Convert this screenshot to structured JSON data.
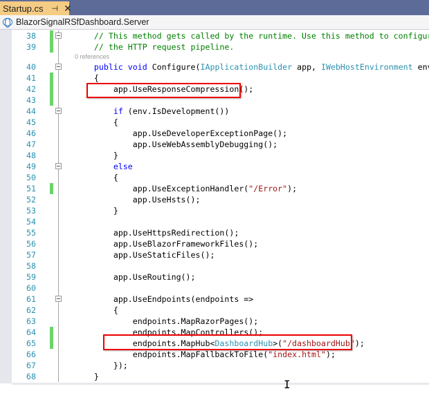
{
  "tab": {
    "label": "Startup.cs",
    "pin_icon": "pin-icon",
    "close_icon": "close-icon"
  },
  "navbar": {
    "project": "BlazorSignalRSfDashboard.Server"
  },
  "codelens": "0 references",
  "lines": [
    {
      "n": "38",
      "chg": true,
      "fold": true,
      "t": [
        [
          "    // This method gets called by the runtime. Use this method to configure",
          "c"
        ]
      ]
    },
    {
      "n": "39",
      "chg": true,
      "t": [
        [
          "    // the HTTP request pipeline.",
          "c"
        ]
      ],
      "lens_after": true
    },
    {
      "n": "40",
      "fold": true,
      "t": [
        [
          "    "
        ],
        [
          "public",
          "k"
        ],
        [
          " "
        ],
        [
          "void",
          "k"
        ],
        [
          " Configure("
        ],
        [
          "IApplicationBuilder",
          "t"
        ],
        [
          " app, "
        ],
        [
          "IWebHostEnvironment",
          "t"
        ],
        [
          " env)"
        ]
      ]
    },
    {
      "n": "41",
      "chg": true,
      "t": [
        [
          "    {"
        ]
      ]
    },
    {
      "n": "42",
      "chg": true,
      "t": [
        [
          "        app.UseResponseCompression();"
        ]
      ]
    },
    {
      "n": "43",
      "chg": true,
      "t": [
        [
          ""
        ]
      ]
    },
    {
      "n": "44",
      "fold": true,
      "t": [
        [
          "        "
        ],
        [
          "if",
          "k"
        ],
        [
          " (env.IsDevelopment())"
        ]
      ]
    },
    {
      "n": "45",
      "t": [
        [
          "        {"
        ]
      ]
    },
    {
      "n": "46",
      "t": [
        [
          "            app.UseDeveloperExceptionPage();"
        ]
      ]
    },
    {
      "n": "47",
      "t": [
        [
          "            app.UseWebAssemblyDebugging();"
        ]
      ]
    },
    {
      "n": "48",
      "t": [
        [
          "        }"
        ]
      ]
    },
    {
      "n": "49",
      "fold": true,
      "t": [
        [
          "        "
        ],
        [
          "else",
          "k"
        ]
      ]
    },
    {
      "n": "50",
      "t": [
        [
          "        {"
        ]
      ]
    },
    {
      "n": "51",
      "chg": true,
      "t": [
        [
          "            app.UseExceptionHandler("
        ],
        [
          "\"/Error\"",
          "s"
        ],
        [
          ");"
        ]
      ]
    },
    {
      "n": "52",
      "t": [
        [
          "            app.UseHsts();"
        ]
      ]
    },
    {
      "n": "53",
      "t": [
        [
          "        }"
        ]
      ]
    },
    {
      "n": "54",
      "t": [
        [
          ""
        ]
      ]
    },
    {
      "n": "55",
      "t": [
        [
          "        app.UseHttpsRedirection();"
        ]
      ]
    },
    {
      "n": "56",
      "t": [
        [
          "        app.UseBlazorFrameworkFiles();"
        ]
      ]
    },
    {
      "n": "57",
      "t": [
        [
          "        app.UseStaticFiles();"
        ]
      ]
    },
    {
      "n": "58",
      "t": [
        [
          ""
        ]
      ]
    },
    {
      "n": "59",
      "t": [
        [
          "        app.UseRouting();"
        ]
      ]
    },
    {
      "n": "60",
      "t": [
        [
          ""
        ]
      ]
    },
    {
      "n": "61",
      "fold": true,
      "t": [
        [
          "        app.UseEndpoints(endpoints =>"
        ]
      ]
    },
    {
      "n": "62",
      "t": [
        [
          "        {"
        ]
      ]
    },
    {
      "n": "63",
      "t": [
        [
          "            endpoints.MapRazorPages();"
        ]
      ]
    },
    {
      "n": "64",
      "chg": true,
      "t": [
        [
          "            endpoints.MapControllers();"
        ]
      ]
    },
    {
      "n": "65",
      "chg": true,
      "t": [
        [
          "            endpoints.MapHub<"
        ],
        [
          "DashboardHub",
          "t"
        ],
        [
          ">("
        ],
        [
          "\"/dashboardHub\"",
          "s"
        ],
        [
          ");"
        ]
      ]
    },
    {
      "n": "66",
      "t": [
        [
          "            endpoints.MapFallbackToFile("
        ],
        [
          "\"index.html\"",
          "s"
        ],
        [
          ");"
        ]
      ]
    },
    {
      "n": "67",
      "t": [
        [
          "        });"
        ]
      ]
    },
    {
      "n": "68",
      "t": [
        [
          "    }"
        ]
      ]
    }
  ],
  "highlight_color": "#e00000"
}
